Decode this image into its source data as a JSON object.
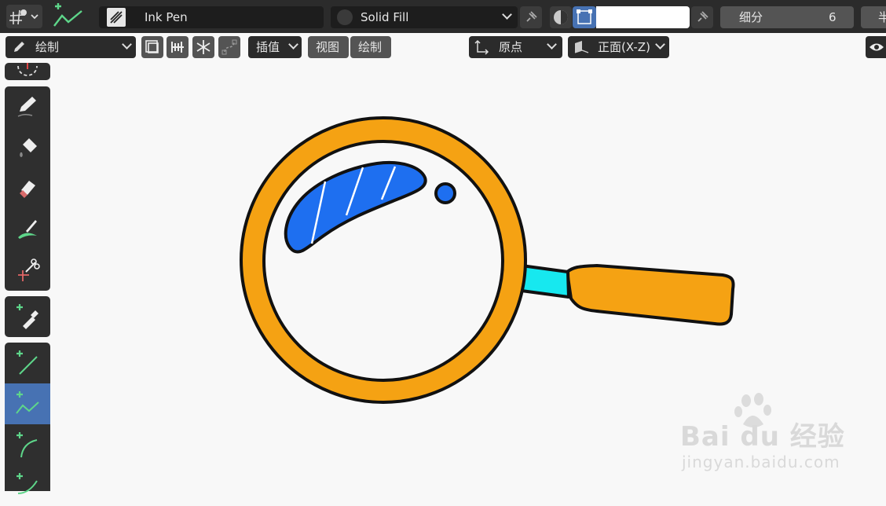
{
  "header": {
    "brush_name": "Ink Pen",
    "material_name": "Solid Fill",
    "material_input_value": "",
    "subdivide_label": "细分",
    "subdivide_value": "6",
    "cut_off_label": "半"
  },
  "subheader": {
    "mode_label": "绘制",
    "interpolate_label": "插值",
    "view_label": "视图",
    "draw_label": "绘制",
    "origin_label": "原点",
    "plane_label": "正面(X-Z)"
  },
  "toolbar": {
    "tools": [
      "draw-tool",
      "fill-tool",
      "erase-tool",
      "tint-tool",
      "cutter-tool",
      "eyedropper-tool",
      "line-tool",
      "polyline-tool",
      "arc-tool",
      "curve-tool"
    ],
    "active_tool": "polyline-tool"
  },
  "canvas": {
    "drawing": "magnifying-glass",
    "colors": {
      "ring": "#f5a213",
      "lens_shine": "#1e6ff0",
      "ferrule": "#17e8ef",
      "handle": "#f5a213",
      "outline": "#111111"
    }
  },
  "watermark": {
    "brand": "Bai du 经验",
    "site": "jingyan.baidu.com"
  },
  "theme": {
    "accent": "#4772b3",
    "panel": "#2b2b2b",
    "green_icon": "#5ed68a"
  }
}
